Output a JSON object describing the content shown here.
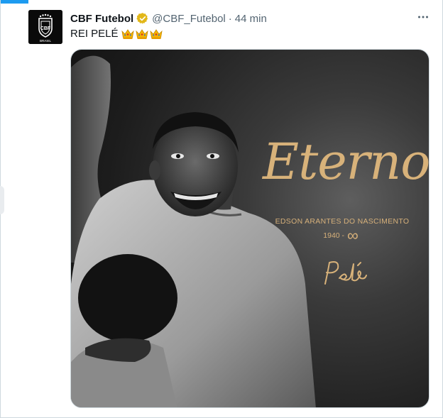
{
  "tweet": {
    "author_name": "CBF Futebol",
    "handle": "@CBF_Futebol",
    "separator": "·",
    "time": "44 min",
    "text": "REI PELÉ",
    "emoji": [
      "crown-emoji",
      "crown-emoji",
      "crown-emoji"
    ],
    "verified_color": "#e2b719"
  },
  "media": {
    "headline": "Eterno",
    "full_name": "EDSON ARANTES DO NASCIMENTO",
    "birth_year": "1940 -",
    "infinity": "∞",
    "accent_color": "#d8b27a"
  },
  "avatar": {
    "icon": "cbf-logo-icon",
    "caption": "BRASIL"
  }
}
